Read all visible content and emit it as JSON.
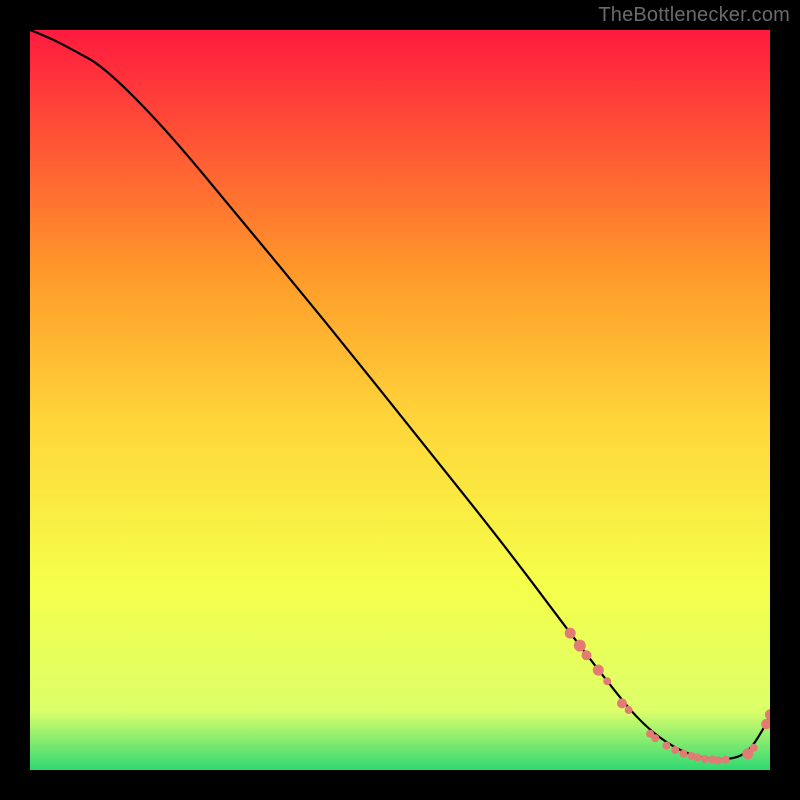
{
  "attribution": "TheBottlenecker.com",
  "colors": {
    "bg": "#000000",
    "curve": "#000000",
    "dot": "#e27b74",
    "grad_top": "#ff1a3f",
    "grad_mid_upper": "#ff9a2a",
    "grad_mid": "#ffd63a",
    "grad_mid_lower": "#f5ff4a",
    "grad_lower": "#dcff6a",
    "grad_bottom": "#30d873"
  },
  "chart_data": {
    "type": "line",
    "title": "",
    "xlabel": "",
    "ylabel": "",
    "xlim": [
      0,
      100
    ],
    "ylim": [
      0,
      100
    ],
    "series": [
      {
        "name": "curve",
        "x": [
          0,
          3,
          6,
          10,
          18,
          28,
          40,
          52,
          64,
          73,
          78,
          82,
          86,
          90,
          94,
          97,
          99.5,
          100
        ],
        "y": [
          100,
          98.8,
          97.2,
          95,
          87,
          75,
          60.5,
          45.5,
          30.5,
          18.5,
          12,
          7,
          3.6,
          1.7,
          1.3,
          2.2,
          6.2,
          7.5
        ]
      }
    ],
    "dots": {
      "name": "markers",
      "points": [
        {
          "x": 73.0,
          "y": 18.5,
          "r": 5.5
        },
        {
          "x": 74.3,
          "y": 16.8,
          "r": 6.0
        },
        {
          "x": 75.2,
          "y": 15.5,
          "r": 5.0
        },
        {
          "x": 76.8,
          "y": 13.5,
          "r": 5.5
        },
        {
          "x": 78.0,
          "y": 12.0,
          "r": 4.0
        },
        {
          "x": 80.0,
          "y": 9.0,
          "r": 5.0
        },
        {
          "x": 80.9,
          "y": 8.1,
          "r": 4.0
        },
        {
          "x": 83.8,
          "y": 4.9,
          "r": 4.0
        },
        {
          "x": 84.5,
          "y": 4.3,
          "r": 4.0
        },
        {
          "x": 86.0,
          "y": 3.3,
          "r": 4.0
        },
        {
          "x": 87.2,
          "y": 2.7,
          "r": 4.0
        },
        {
          "x": 88.3,
          "y": 2.2,
          "r": 4.0
        },
        {
          "x": 89.4,
          "y": 1.9,
          "r": 4.0
        },
        {
          "x": 90.2,
          "y": 1.7,
          "r": 4.0
        },
        {
          "x": 91.2,
          "y": 1.5,
          "r": 4.0
        },
        {
          "x": 92.2,
          "y": 1.4,
          "r": 4.0
        },
        {
          "x": 93.0,
          "y": 1.3,
          "r": 4.0
        },
        {
          "x": 94.0,
          "y": 1.4,
          "r": 4.0
        },
        {
          "x": 97.0,
          "y": 2.2,
          "r": 5.5
        },
        {
          "x": 97.8,
          "y": 3.0,
          "r": 4.0
        },
        {
          "x": 99.5,
          "y": 6.2,
          "r": 5.2
        },
        {
          "x": 100.0,
          "y": 7.5,
          "r": 5.2
        }
      ]
    },
    "annotation": {
      "text": "",
      "x": 89,
      "y": 3.2,
      "font_px": 9
    }
  }
}
